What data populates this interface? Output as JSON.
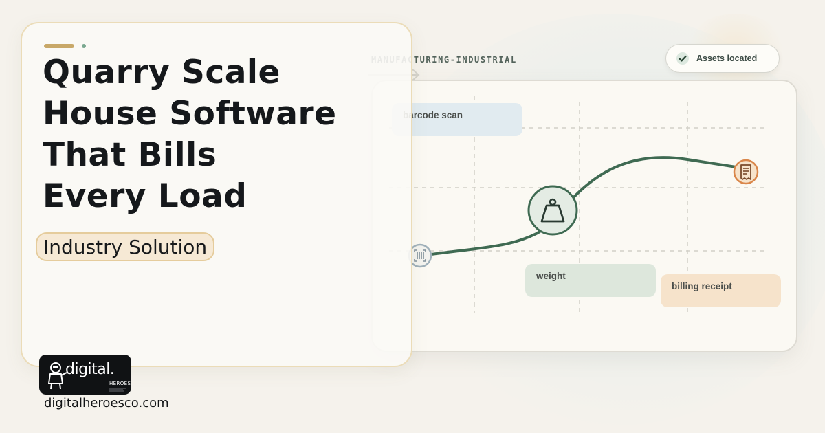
{
  "section_label": "MANUFACTURING-INDUSTRIAL",
  "assets_status": "Assets located",
  "card": {
    "title_lines": [
      "Quarry Scale",
      "House Software",
      "That Bills",
      "Every Load"
    ],
    "category_label": "Industry Solution"
  },
  "flow": {
    "step_labels": {
      "scan": "barcode scan",
      "weigh": "weight",
      "bill": "billing receipt"
    },
    "icons": [
      "barcode-icon",
      "weight-icon",
      "receipt-icon",
      "check-icon"
    ]
  },
  "brand": {
    "logo_text": "digital.",
    "logo_subtext": "HEROES.",
    "url": "digitalheroesco.com"
  },
  "colors": {
    "accent_green": "#3f6a52",
    "accent_gold": "#c8a868",
    "receipt_orange": "#d9864a",
    "scan_blue": "#e1ebf0",
    "weight_green": "#dde7dc",
    "billing_peach": "#f6e3cb"
  }
}
